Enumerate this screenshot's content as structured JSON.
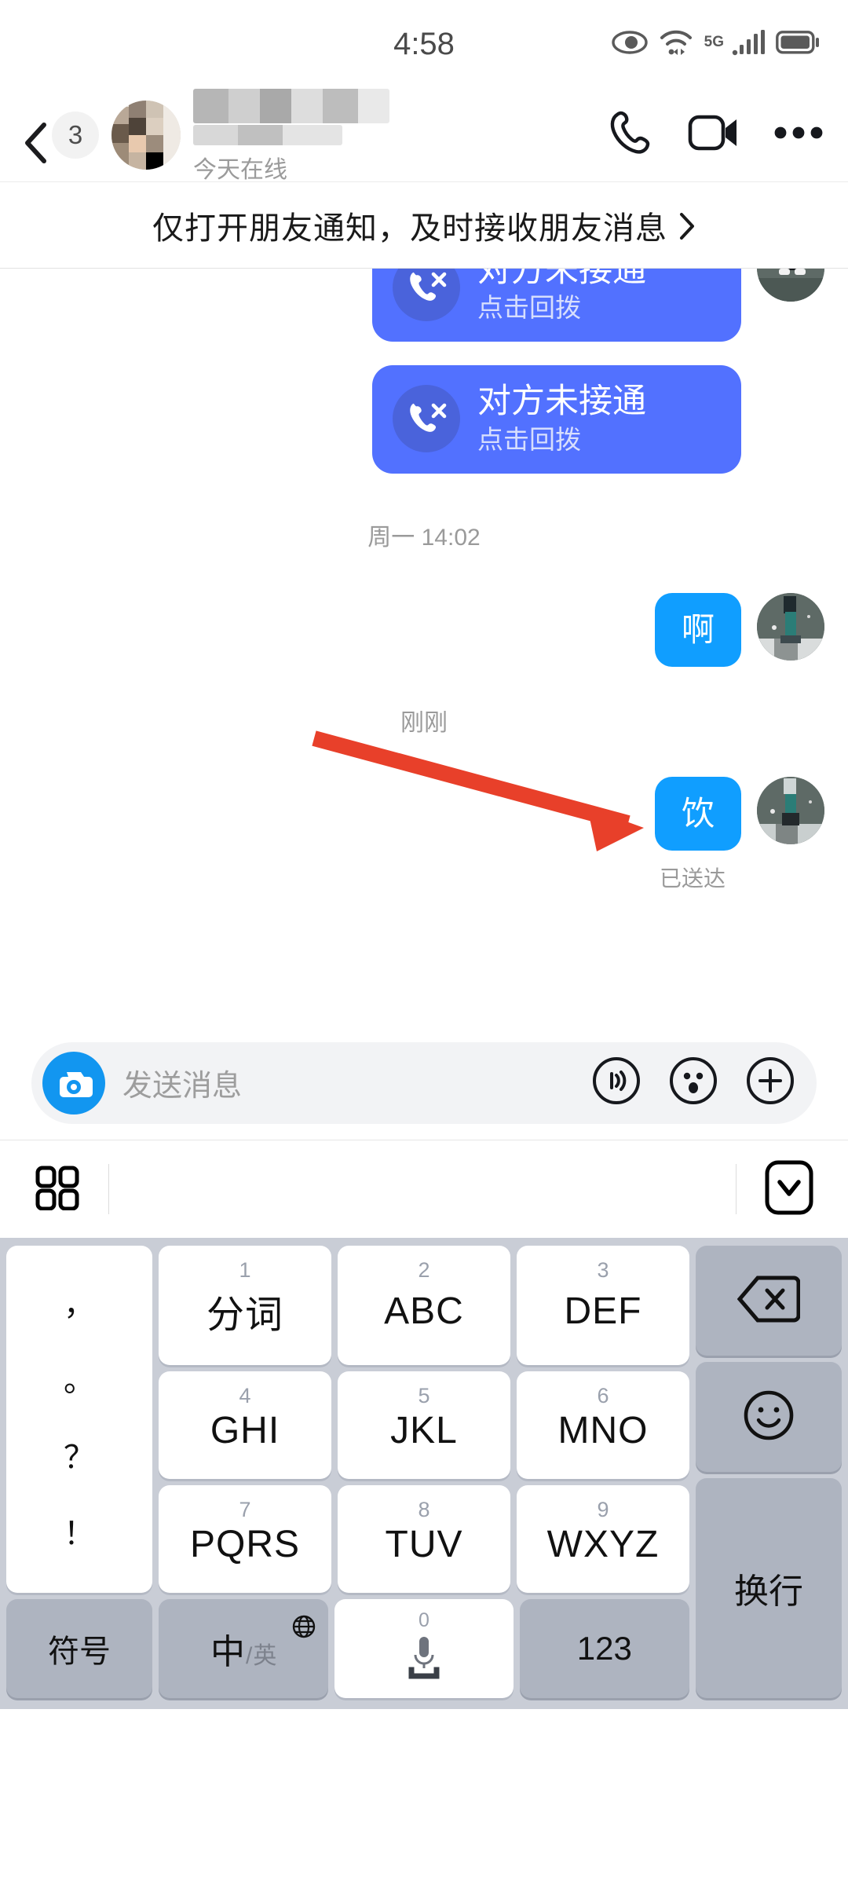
{
  "status_bar": {
    "time": "4:58",
    "network_label": "5G",
    "icons": [
      "eye-care-icon",
      "wifi-icon",
      "signal-bars-icon",
      "battery-icon"
    ]
  },
  "chat_header": {
    "back_badge_count": "3",
    "contact_name_redacted": "",
    "subtitle": "今天在线",
    "actions": [
      "voice-call-icon",
      "video-call-icon",
      "more-options-icon"
    ]
  },
  "banner": {
    "text": "仅打开朋友通知，及时接收朋友消息",
    "chevron": "chevron-right-icon"
  },
  "conversation": {
    "messages": [
      {
        "type": "call",
        "title": "对方未接通",
        "subtitle": "点击回拨"
      },
      {
        "type": "call",
        "title": "对方未接通",
        "subtitle": "点击回拨"
      },
      {
        "type": "timestamp",
        "text": "周一 14:02"
      },
      {
        "type": "text",
        "text": "啊"
      },
      {
        "type": "timestamp",
        "text": "刚刚"
      },
      {
        "type": "text",
        "text": "饮",
        "status": "已送达"
      }
    ],
    "delivered_label": "已送达",
    "bubble_color": "#109eff",
    "call_bubble_color": "#5271ff",
    "annotation_arrow_color": "#e8402a"
  },
  "input_bar": {
    "camera_icon": "camera-icon",
    "placeholder": "发送消息",
    "value": "",
    "icons": [
      "voice-message-icon",
      "emoji-icon",
      "add-more-icon"
    ]
  },
  "keyboard_toolbar": {
    "grid_icon": "keyboard-panel-grid-icon",
    "hide_icon": "hide-keyboard-icon"
  },
  "keyboard": {
    "punctuation_column": [
      "，",
      "。",
      "？",
      "！"
    ],
    "rows": [
      [
        {
          "num": "1",
          "label": "分词"
        },
        {
          "num": "2",
          "label": "ABC"
        },
        {
          "num": "3",
          "label": "DEF"
        }
      ],
      [
        {
          "num": "4",
          "label": "GHI"
        },
        {
          "num": "5",
          "label": "JKL"
        },
        {
          "num": "6",
          "label": "MNO"
        }
      ],
      [
        {
          "num": "7",
          "label": "PQRS"
        },
        {
          "num": "8",
          "label": "TUV"
        },
        {
          "num": "9",
          "label": "WXYZ"
        }
      ]
    ],
    "right_column": [
      {
        "name": "backspace",
        "label": ""
      },
      {
        "name": "emoji",
        "label": ""
      },
      {
        "name": "enter",
        "label": "换行"
      }
    ],
    "bottom_row": [
      {
        "name": "symbols",
        "label": "符号"
      },
      {
        "name": "language-toggle",
        "label_cn": "中",
        "label_slash": "/",
        "label_en": "英"
      },
      {
        "name": "space",
        "label": "0"
      },
      {
        "name": "numbers",
        "label": "123"
      }
    ]
  }
}
